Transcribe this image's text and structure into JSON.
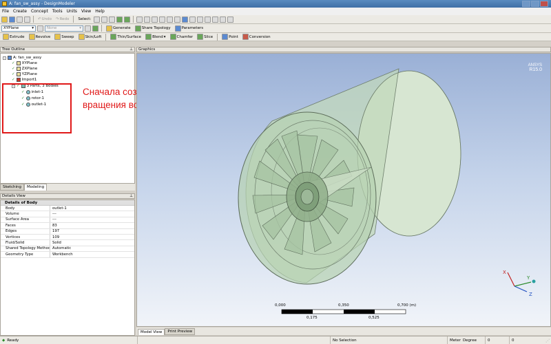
{
  "window": {
    "title": "A: fan_sw_assy - DesignModeler"
  },
  "menu": [
    "File",
    "Create",
    "Concept",
    "Tools",
    "Units",
    "View",
    "Help"
  ],
  "toolbar1": {
    "undo": "Undo",
    "redo": "Redo",
    "select": "Select:"
  },
  "toolbar2": {
    "plane": "XYPlane",
    "sketch": "None",
    "generate": "Generate",
    "share_topology": "Share Topology",
    "parameters": "Parameters"
  },
  "toolbar3": {
    "extrude": "Extrude",
    "revolve": "Revolve",
    "sweep": "Sweep",
    "skin_loft": "Skin/Loft",
    "thin_surface": "Thin/Surface",
    "blend": "Blend",
    "chamfer": "Chamfer",
    "slice": "Slice",
    "point": "Point",
    "conversion": "Conversion"
  },
  "tree_outline": {
    "title": "Tree Outline",
    "root": "A: fan_sw_assy",
    "planes": [
      "XYPlane",
      "ZXPlane",
      "YZPlane"
    ],
    "import": "Import1",
    "parts": "3 Parts, 3 Bodies",
    "bodies": [
      "inlet-1",
      "rotor-1",
      "outlet-1"
    ]
  },
  "tabs": {
    "sketching": "Sketching",
    "modeling": "Modeling"
  },
  "annotation": {
    "line1": "Сначала создаю объет",
    "line2": "вращения вокруг ротора"
  },
  "details": {
    "title": "Details View",
    "section": "Details of Body",
    "rows": [
      {
        "k": "Body",
        "v": "outlet-1"
      },
      {
        "k": "Volume",
        "v": "---"
      },
      {
        "k": "Surface Area",
        "v": "---"
      },
      {
        "k": "Faces",
        "v": "83"
      },
      {
        "k": "Edges",
        "v": "197"
      },
      {
        "k": "Vertices",
        "v": "109"
      },
      {
        "k": "Fluid/Solid",
        "v": "Solid"
      },
      {
        "k": "Shared Topology Method",
        "v": "Automatic"
      },
      {
        "k": "Geometry Type",
        "v": "Workbench"
      }
    ]
  },
  "graphics": {
    "title": "Graphics",
    "brand": "ANSYS",
    "version": "R15.0",
    "scale": {
      "top": [
        "0,000",
        "0,350",
        "0,700 (m)"
      ],
      "bottom": [
        "0,175",
        "0,525"
      ]
    },
    "tabs": {
      "model_view": "Model View",
      "print_preview": "Print Preview"
    },
    "axes": {
      "x": "X",
      "y": "Y",
      "z": "Z"
    }
  },
  "status": {
    "ready": "Ready",
    "selection": "No Selection",
    "units": "Meter",
    "angle": "Degree",
    "v1": "0",
    "v2": "0"
  },
  "colors": {
    "annotation": "#e01818",
    "title_bar": "#3f6fa6",
    "body_fill": "#b7d2b0"
  }
}
